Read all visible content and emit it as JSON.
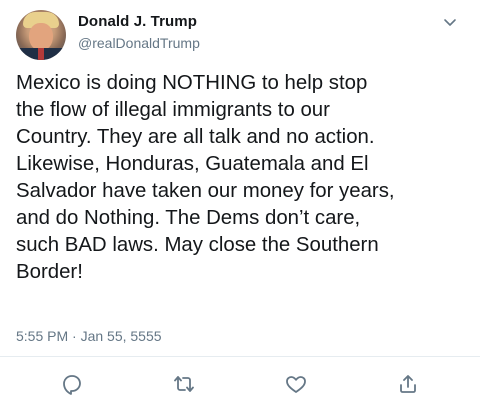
{
  "tweet": {
    "display_name": "Donald J. Trump",
    "handle": "@realDonaldTrump",
    "text": "Mexico is doing NOTHING to help stop\nthe flow of illegal immigrants to our\nCountry. They are all talk and no action.\nLikewise, Honduras, Guatemala and El\nSalvador have taken our money for years,\nand do Nothing. The Dems don’t care,\nsuch BAD laws. May close the Southern\nBorder!",
    "timestamp": "5:55 PM · Jan 55, 5555"
  },
  "icons": {
    "menu": "chevron-down-icon",
    "reply": "comment-icon",
    "retweet": "retweet-icon",
    "like": "heart-icon",
    "share": "share-icon"
  },
  "colors": {
    "text_primary": "#14171a",
    "text_secondary": "#657786",
    "icon": "#657786",
    "divider": "#e6ecf0"
  }
}
